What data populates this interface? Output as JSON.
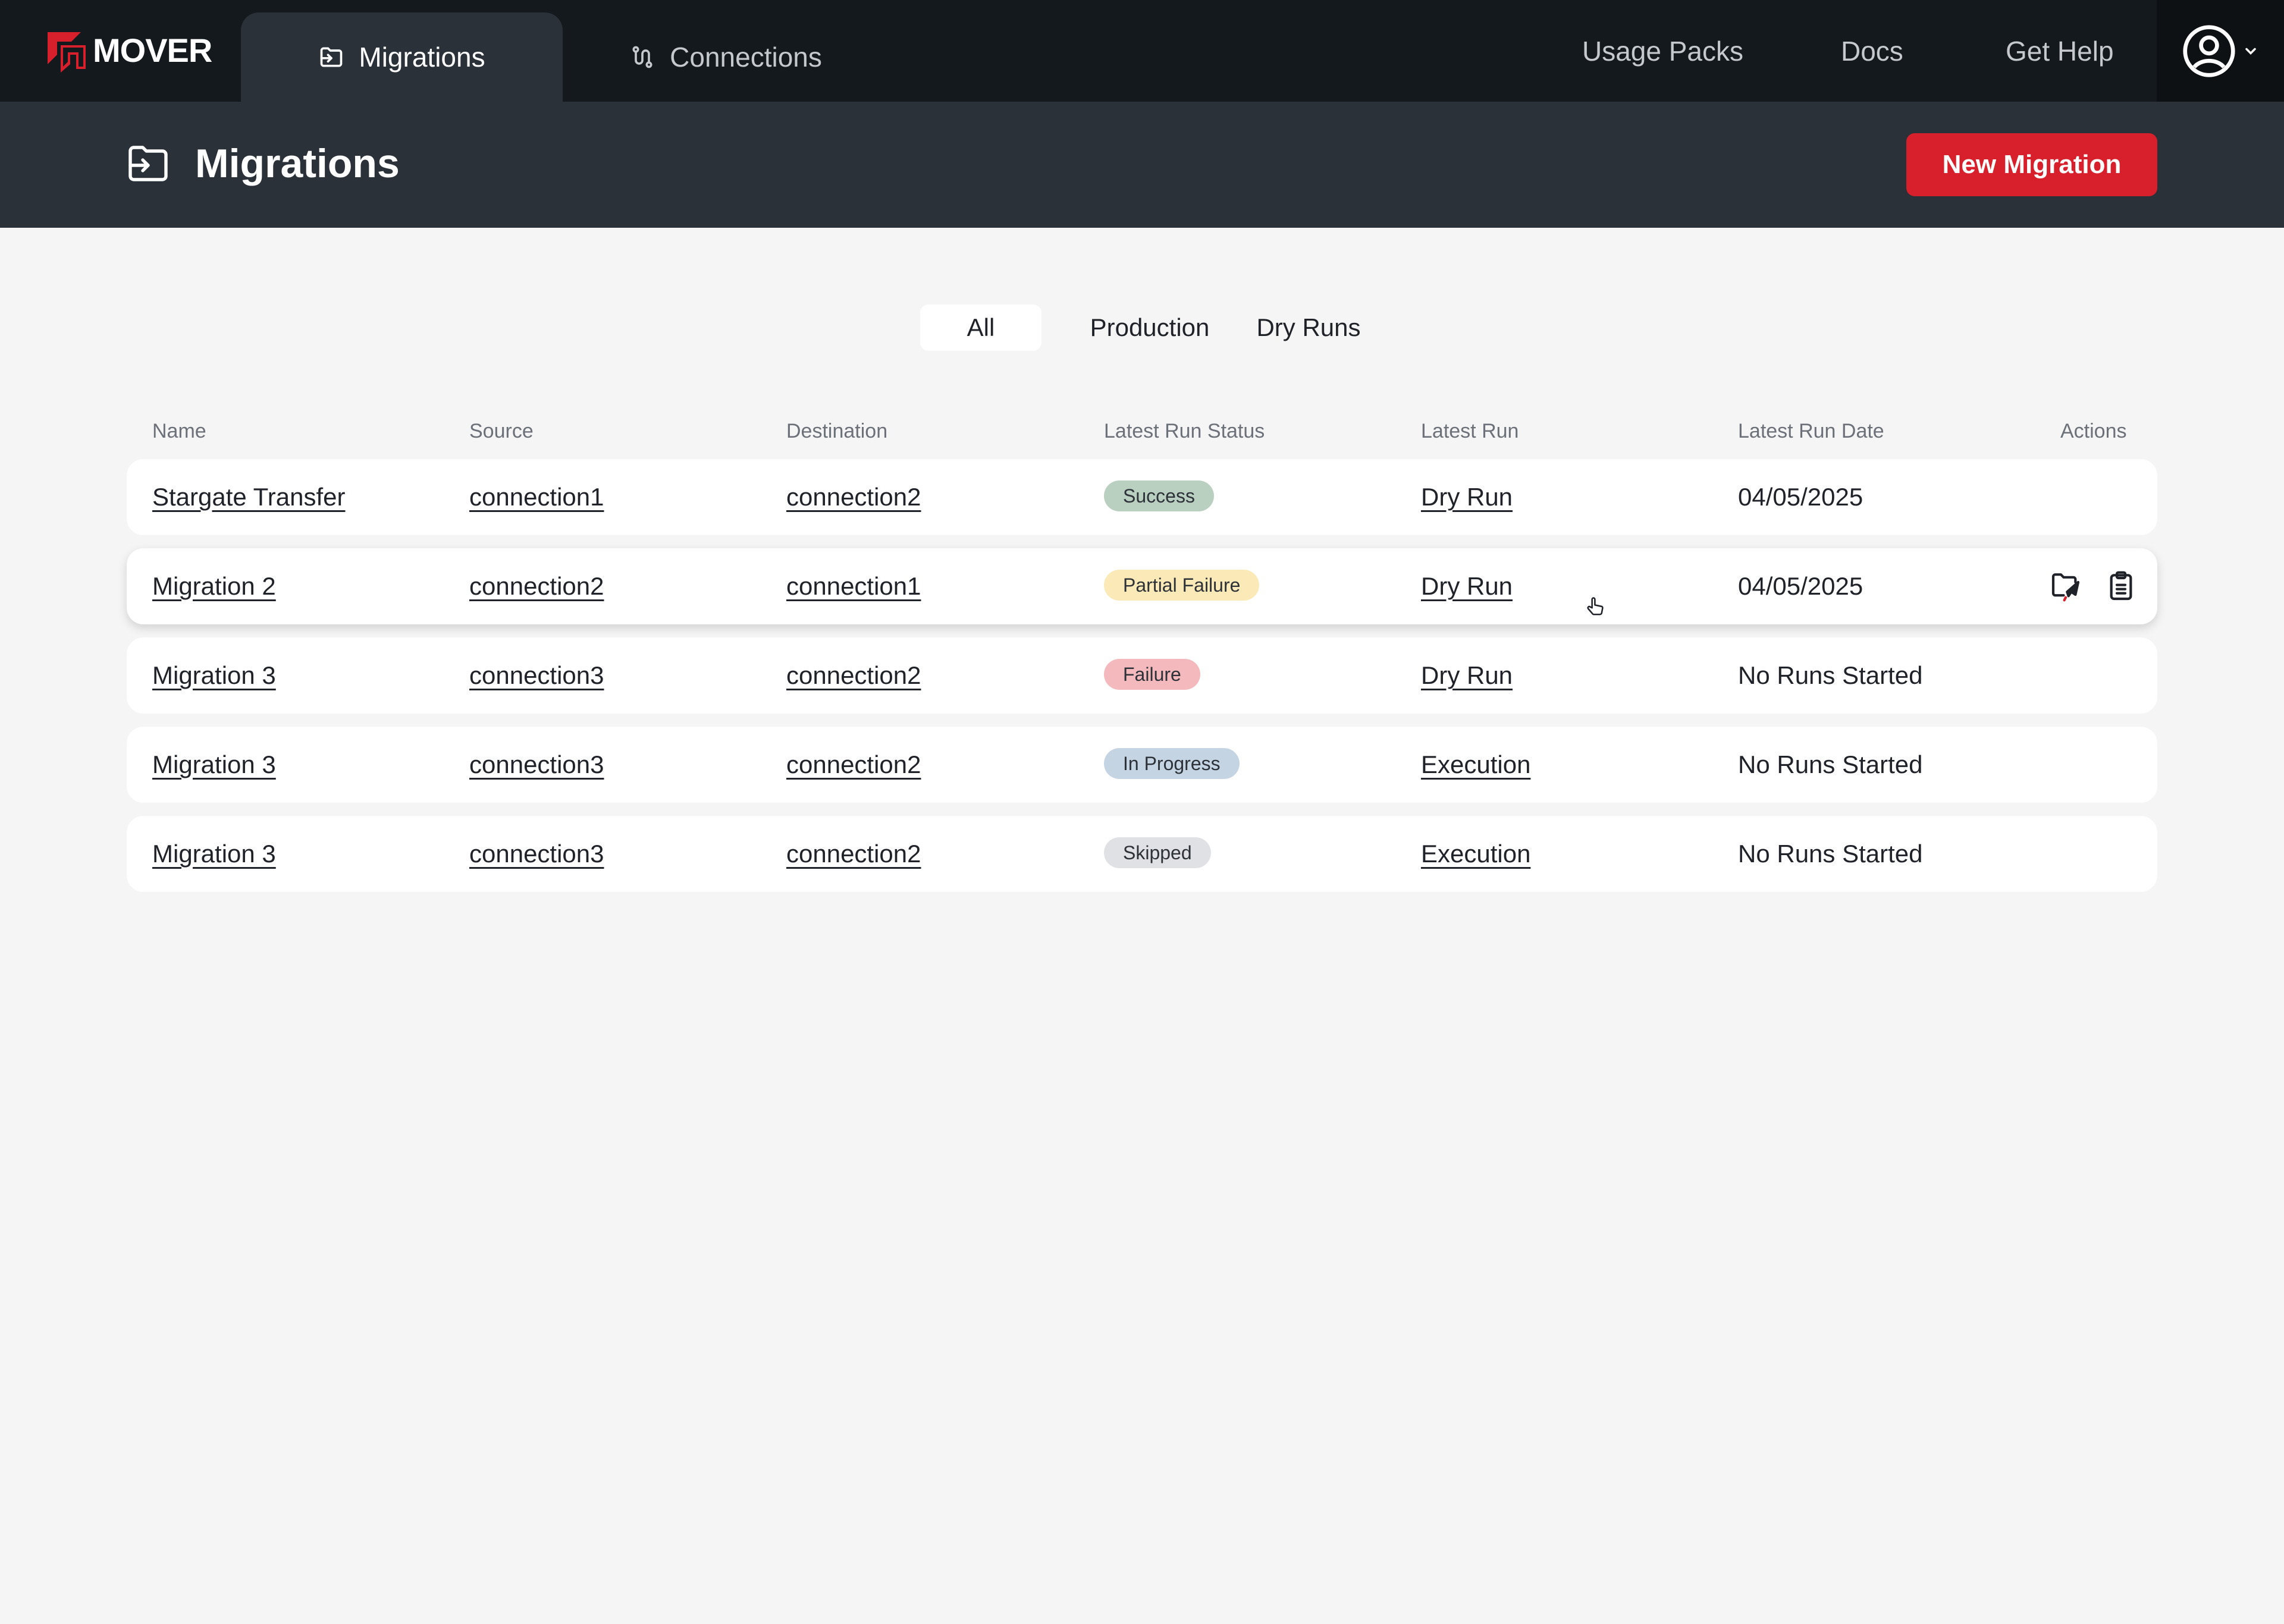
{
  "brand": {
    "name": "MOVER"
  },
  "nav": {
    "tabs": [
      {
        "label": "Migrations",
        "icon": "folder-import-icon",
        "active": true
      },
      {
        "label": "Connections",
        "icon": "connection-route-icon",
        "active": false
      }
    ],
    "links": [
      "Usage Packs",
      "Docs",
      "Get Help"
    ],
    "user_icon": "user-circle-icon"
  },
  "page": {
    "title": "Migrations",
    "icon": "folder-import-icon",
    "new_button": "New Migration"
  },
  "filters": {
    "items": [
      "All",
      "Production",
      "Dry Runs"
    ],
    "active": "All"
  },
  "table": {
    "headers": [
      "Name",
      "Source",
      "Destination",
      "Latest Run Status",
      "Latest Run",
      "Latest Run Date",
      "Actions"
    ],
    "rows": [
      {
        "name": "Stargate Transfer",
        "source": "connection1",
        "destination": "connection2",
        "status": "Success",
        "latest_run": "Dry Run",
        "date": "04/05/2025"
      },
      {
        "name": "Migration 2",
        "source": "connection2",
        "destination": "connection1",
        "status": "Partial Failure",
        "latest_run": "Dry Run",
        "date": "04/05/2025",
        "actions": [
          "run-migration-icon",
          "clipboard-icon"
        ]
      },
      {
        "name": "Migration 3",
        "source": "connection3",
        "destination": "connection2",
        "status": "Failure",
        "latest_run": "Dry Run",
        "date": "No Runs Started"
      },
      {
        "name": "Migration 3",
        "source": "connection3",
        "destination": "connection2",
        "status": "In Progress",
        "latest_run": "Execution",
        "date": "No Runs Started"
      },
      {
        "name": "Migration 3",
        "source": "connection3",
        "destination": "connection2",
        "status": "Skipped",
        "latest_run": "Execution",
        "date": "No Runs Started"
      }
    ]
  },
  "colors": {
    "accent": "#d8202c",
    "nav_bg": "#14191d",
    "header_bg": "#2b3138",
    "status_success": "#b9cfc0",
    "status_partial_failure": "#fbeab7",
    "status_failure": "#f4b9bd",
    "status_in_progress": "#c5d4e3",
    "status_skipped": "#dfe1e4"
  }
}
